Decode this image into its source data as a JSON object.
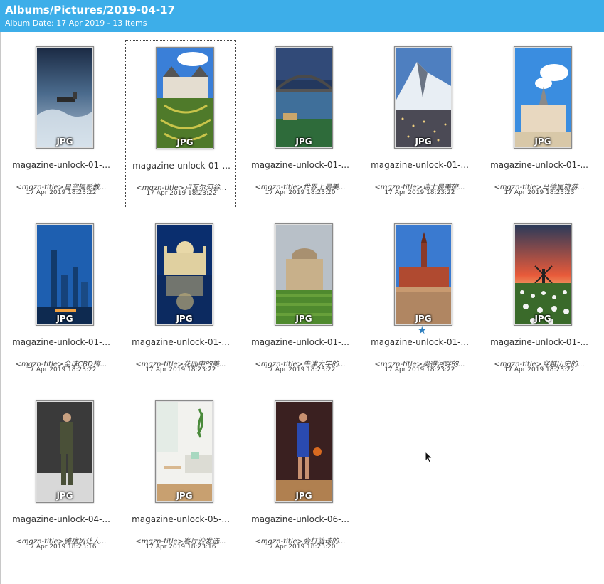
{
  "header": {
    "title": "Albums/Pictures/2019-04-17",
    "subtitle": "Album Date: 17 Apr 2019 - 13 Items"
  },
  "items": [
    {
      "filename": "magazine-unlock-01-...",
      "title": "<mgzn-title>星空摄影教...",
      "date": "17 Apr 2019 18:23:22",
      "format": "JPG",
      "scene": "storm-sea"
    },
    {
      "filename": "magazine-unlock-01-...",
      "title": "<mgzn-title>卢瓦尔河谷...",
      "date": "17 Apr 2019 18:23:22",
      "format": "JPG",
      "scene": "chateau-garden"
    },
    {
      "filename": "magazine-unlock-01-...",
      "title": "<mgzn-title>世界上最美...",
      "date": "17 Apr 2019 18:23:20",
      "format": "JPG",
      "scene": "harbour-bridge"
    },
    {
      "filename": "magazine-unlock-01-...",
      "title": "<mgzn-title>瑞士最美旅...",
      "date": "17 Apr 2019 18:23:22",
      "format": "JPG",
      "scene": "matterhorn"
    },
    {
      "filename": "magazine-unlock-01-...",
      "title": "<mgzn-title>马德里旅游...",
      "date": "17 Apr 2019 18:23:23",
      "format": "JPG",
      "scene": "palace-sky"
    },
    {
      "filename": "magazine-unlock-01-...",
      "title": "<mgzn-title>全球CBD排...",
      "date": "17 Apr 2019 18:23:22",
      "format": "JPG",
      "scene": "city-night"
    },
    {
      "filename": "magazine-unlock-01-...",
      "title": "<mgzn-title>花园中的美...",
      "date": "17 Apr 2019 18:23:22",
      "format": "JPG",
      "scene": "church-reflection"
    },
    {
      "filename": "magazine-unlock-01-...",
      "title": "<mgzn-title>牛津大学的...",
      "date": "17 Apr 2019 18:23:22",
      "format": "JPG",
      "scene": "radcliffe"
    },
    {
      "filename": "magazine-unlock-01-...",
      "title": "<mgzn-title>奥得河畔的...",
      "date": "17 Apr 2019 18:23:22",
      "format": "JPG",
      "scene": "riverside-church"
    },
    {
      "filename": "magazine-unlock-01-...",
      "title": "<mgzn-title>穿越历史的...",
      "date": "17 Apr 2019 18:23:22",
      "format": "JPG",
      "scene": "windmill-tulips"
    },
    {
      "filename": "magazine-unlock-04-...",
      "title": "<mgzn-title>雅痞风让人...",
      "date": "17 Apr 2019 18:23:16",
      "format": "JPG",
      "scene": "runway"
    },
    {
      "filename": "magazine-unlock-05-...",
      "title": "<mgzn-title>客厅沙发选...",
      "date": "17 Apr 2019 18:23:16",
      "format": "JPG",
      "scene": "living-room"
    },
    {
      "filename": "magazine-unlock-06-...",
      "title": "<mgzn-title>会打篮球的...",
      "date": "17 Apr 2019 18:23:20",
      "format": "JPG",
      "scene": "basketball"
    }
  ],
  "selected_index": 1,
  "starred_index": 8,
  "icons": {
    "star": "star-icon",
    "cursor": "mouse-pointer-icon"
  },
  "colors": {
    "header_bg": "#3daee9",
    "star": "#2f7fbf"
  }
}
